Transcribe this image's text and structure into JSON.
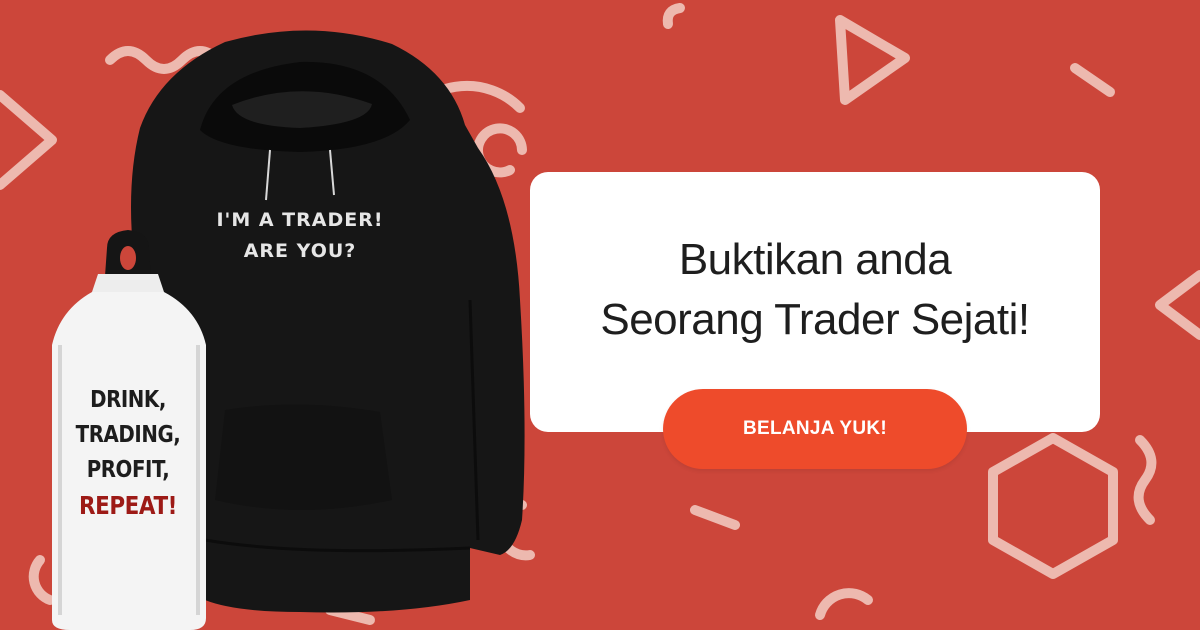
{
  "banner": {
    "background_color": "#cc463a",
    "decoration_color": "#f1c5bd"
  },
  "hoodie": {
    "print_lines": [
      "I'M A TRADER!",
      "ARE YOU?"
    ]
  },
  "bottle": {
    "print_lines": [
      "DRINK,",
      "TRADING,",
      "PROFIT,"
    ],
    "print_accent": "REPEAT!",
    "accent_color": "#9d1a16"
  },
  "card": {
    "headline_line1": "Buktikan anda",
    "headline_line2": "Seorang Trader Sejati!"
  },
  "cta": {
    "label": "BELANJA YUK!",
    "color": "#ee4b2b"
  }
}
